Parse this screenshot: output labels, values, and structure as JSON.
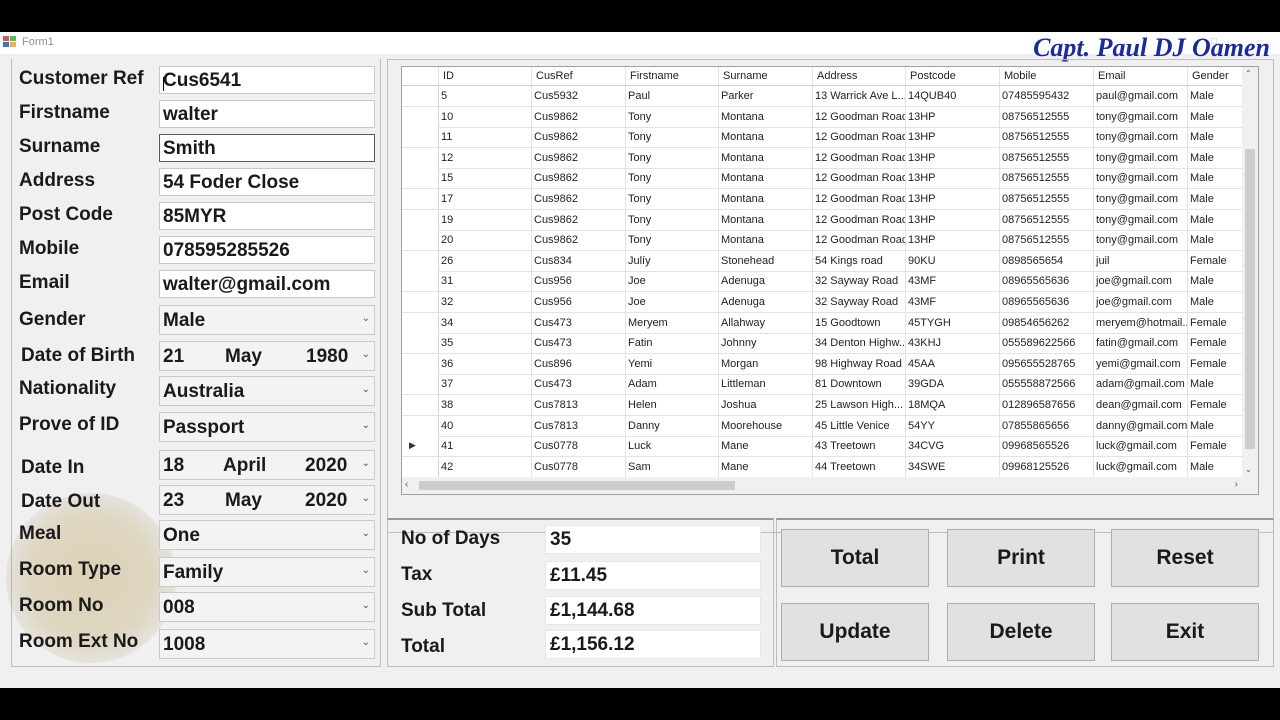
{
  "window": {
    "title": "Form1",
    "author": "Capt. Paul DJ Oamen"
  },
  "form": {
    "customer_ref": {
      "label": "Customer Ref",
      "value": "Cus6541"
    },
    "firstname": {
      "label": "Firstname",
      "value": "walter"
    },
    "surname": {
      "label": "Surname",
      "value": "Smith"
    },
    "address": {
      "label": "Address",
      "value": "54 Foder Close"
    },
    "post_code": {
      "label": "Post Code",
      "value": "85MYR"
    },
    "mobile": {
      "label": "Mobile",
      "value": "078595285526"
    },
    "email": {
      "label": "Email",
      "value": "walter@gmail.com"
    },
    "gender": {
      "label": "Gender",
      "value": "Male"
    },
    "dob": {
      "label": "Date of Birth",
      "day": "21",
      "month": "May",
      "year": "1980"
    },
    "nationality": {
      "label": "Nationality",
      "value": "Australia"
    },
    "prove_of_id": {
      "label": "Prove of ID",
      "value": "Passport"
    },
    "date_in": {
      "label": "Date In",
      "day": "18",
      "month": "April",
      "year": "2020"
    },
    "date_out": {
      "label": "Date Out",
      "day": "23",
      "month": "May",
      "year": "2020"
    },
    "meal": {
      "label": "Meal",
      "value": "One"
    },
    "room_type": {
      "label": "Room Type",
      "value": "Family"
    },
    "room_no": {
      "label": "Room No",
      "value": "008"
    },
    "room_ext_no": {
      "label": "Room Ext No",
      "value": "1008"
    }
  },
  "grid": {
    "columns": [
      "ID",
      "CusRef",
      "Firstname",
      "Surname",
      "Address",
      "Postcode",
      "Mobile",
      "Email",
      "Gender"
    ],
    "rows": [
      [
        "5",
        "Cus5932",
        "Paul",
        "Parker",
        "13 Warrick Ave L...",
        "14QUB40",
        "07485595432",
        "paul@gmail.com",
        "Male"
      ],
      [
        "10",
        "Cus9862",
        "Tony",
        "Montana",
        "12 Goodman Road",
        "13HP",
        "08756512555",
        "tony@gmail.com",
        "Male"
      ],
      [
        "11",
        "Cus9862",
        "Tony",
        "Montana",
        "12 Goodman Road",
        "13HP",
        "08756512555",
        "tony@gmail.com",
        "Male"
      ],
      [
        "12",
        "Cus9862",
        "Tony",
        "Montana",
        "12 Goodman Road",
        "13HP",
        "08756512555",
        "tony@gmail.com",
        "Male"
      ],
      [
        "15",
        "Cus9862",
        "Tony",
        "Montana",
        "12 Goodman Road",
        "13HP",
        "08756512555",
        "tony@gmail.com",
        "Male"
      ],
      [
        "17",
        "Cus9862",
        "Tony",
        "Montana",
        "12 Goodman Road",
        "13HP",
        "08756512555",
        "tony@gmail.com",
        "Male"
      ],
      [
        "19",
        "Cus9862",
        "Tony",
        "Montana",
        "12 Goodman Road",
        "13HP",
        "08756512555",
        "tony@gmail.com",
        "Male"
      ],
      [
        "20",
        "Cus9862",
        "Tony",
        "Montana",
        "12 Goodman Road",
        "13HP",
        "08756512555",
        "tony@gmail.com",
        "Male"
      ],
      [
        "26",
        "Cus834",
        "Julíy",
        "Stonehead",
        "54 Kings road",
        "90KU",
        "0898565654",
        "juil",
        "Female"
      ],
      [
        "31",
        "Cus956",
        "Joe",
        "Adenuga",
        "32 Sayway Road",
        "43MF",
        "08965565636",
        "joe@gmail.com",
        "Male"
      ],
      [
        "32",
        "Cus956",
        "Joe",
        "Adenuga",
        "32 Sayway Road",
        "43MF",
        "08965565636",
        "joe@gmail.com",
        "Male"
      ],
      [
        "34",
        "Cus473",
        "Meryem",
        "Allahway",
        "15 Goodtown",
        "45TYGH",
        "09854656262",
        "meryem@hotmail....",
        "Female"
      ],
      [
        "35",
        "Cus473",
        "Fatin",
        "Johnny",
        "34 Denton Highw...",
        "43KHJ",
        "055589622566",
        "fatin@gmail.com",
        "Female"
      ],
      [
        "36",
        "Cus896",
        "Yemi",
        "Morgan",
        "98 Highway Road",
        "45AA",
        "095655528765",
        "yemi@gmail.com",
        "Female"
      ],
      [
        "37",
        "Cus473",
        "Adam",
        "Littleman",
        "81 Downtown",
        "39GDA",
        "055558872566",
        "adam@gmail.com",
        "Male"
      ],
      [
        "38",
        "Cus7813",
        "Helen",
        "Joshua",
        "25 Lawson High...",
        "18MQA",
        "012896587656",
        "dean@gmail.com",
        "Female"
      ],
      [
        "40",
        "Cus7813",
        "Danny",
        "Moorehouse",
        "45 Little Venice",
        "54YY",
        "07855865656",
        "danny@gmail.com",
        "Male"
      ],
      [
        "41",
        "Cus0778",
        "Luck",
        "Mane",
        "43 Treetown",
        "34CVG",
        "09968565526",
        "luck@gmail.com",
        "Female"
      ],
      [
        "42",
        "Cus0778",
        "Sam",
        "Mane",
        "44 Treetown",
        "34SWE",
        "09968125526",
        "luck@gmail.com",
        "Male"
      ]
    ],
    "current_row": 17
  },
  "calc": {
    "days": {
      "label": "No of Days",
      "value": "35"
    },
    "tax": {
      "label": "Tax",
      "value": "£11.45"
    },
    "sub_total": {
      "label": "Sub Total",
      "value": "£1,144.68"
    },
    "total": {
      "label": "Total",
      "value": "£1,156.12"
    }
  },
  "buttons": {
    "total": "Total",
    "print": "Print",
    "reset": "Reset",
    "update": "Update",
    "delete": "Delete",
    "exit": "Exit"
  },
  "colors": {
    "author": "#1c2b9a",
    "window": "#f0f0f0",
    "button": "#e1e1e1"
  }
}
